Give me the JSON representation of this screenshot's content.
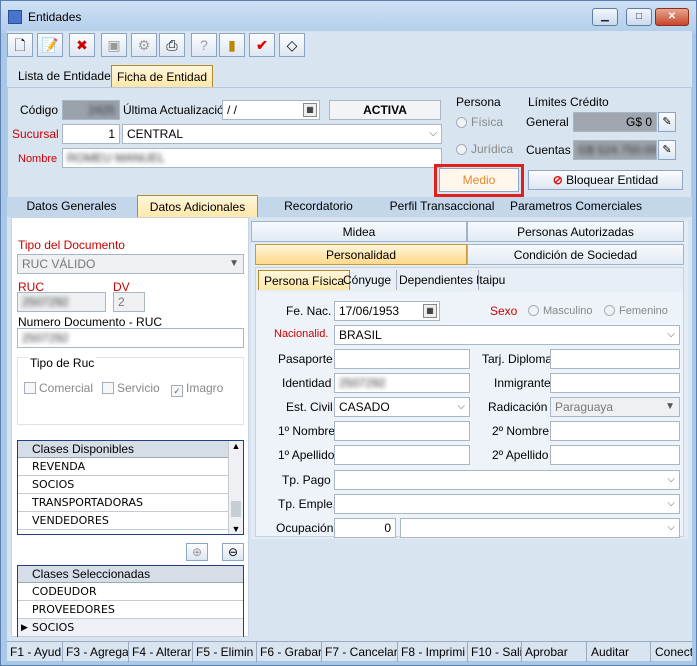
{
  "window": {
    "title": "Entidades"
  },
  "toolbar": {
    "icons": [
      "new-document-icon",
      "edit-document-icon",
      "delete-icon",
      "save-icon",
      "tools-icon",
      "print-icon",
      "help-icon",
      "exit-door-icon",
      "check-icon",
      "eraser-icon"
    ]
  },
  "main_tabs": [
    {
      "label": "Lista de Entidades"
    },
    {
      "label": "Ficha de Entidad"
    }
  ],
  "header": {
    "codigo_label": "Código",
    "codigo_value": "2425",
    "ultima_label": "Última Actualización",
    "ultima_value": "/ /",
    "status": "ACTIVA",
    "sucursal_label": "Sucursal",
    "sucursal_num": "1",
    "sucursal_name": "CENTRAL",
    "nombre_label": "Nombre",
    "nombre_value": "ROMEU MANUEL",
    "persona_label": "Persona",
    "fisica_label": "Física",
    "juridica_label": "Jurídica",
    "limites_label": "Límites Crédito",
    "general_label": "General",
    "general_value": "G$ 0",
    "cuentas_label": "Cuentas",
    "cuentas_value": "G$ 524.750.000",
    "medio_label": "Medio",
    "bloquear_label": "Bloquear Entidad"
  },
  "section_tabs": [
    {
      "label": "Datos Generales"
    },
    {
      "label": "Datos Adicionales"
    },
    {
      "label": "Recordatorio"
    },
    {
      "label": "Perfil Transaccional"
    },
    {
      "label": "Parametros Comerciales"
    }
  ],
  "left": {
    "tipo_doc_label": "Tipo del Documento",
    "tipo_doc_value": "RUC VÁLIDO",
    "ruc_label": "RUC",
    "ruc_value": "2507292",
    "dv_label": "DV",
    "dv_value": "2",
    "numdoc_label": "Numero Documento - RUC",
    "numdoc_value": "2507292",
    "tipo_ruc_label": "Tipo de Ruc",
    "comercial_label": "Comercial",
    "servicio_label": "Servicio",
    "imagro_label": "Imagro",
    "disponibles_header": "Clases Disponibles",
    "disponibles": [
      "REVENDA",
      "SOCIOS",
      "TRANSPORTADORAS",
      "VENDEDORES"
    ],
    "seleccionadas_header": "Clases Seleccionadas",
    "seleccionadas": [
      "CODEUDOR",
      "PROVEEDORES",
      "SOCIOS"
    ]
  },
  "right_tabs_row1": [
    {
      "label": "Midea"
    },
    {
      "label": "Personas Autorizadas"
    }
  ],
  "right_tabs_row2": [
    {
      "label": "Personalidad"
    },
    {
      "label": "Condición de Sociedad"
    }
  ],
  "right_tabs_row3": [
    {
      "label": "Persona Física"
    },
    {
      "label": "Cónyuge"
    },
    {
      "label": "Dependientes"
    },
    {
      "label": "Itaipu"
    }
  ],
  "form": {
    "fe_nac_label": "Fe. Nac.",
    "fe_nac_value": "17/06/1953",
    "sexo_label": "Sexo",
    "masculino_label": "Masculino",
    "femenino_label": "Femenino",
    "nacionalid_label": "Nacionalid.",
    "nacionalid_value": "BRASIL",
    "pasaporte_label": "Pasaporte",
    "tarj_label": "Tarj. Diploma",
    "identidad_label": "Identidad",
    "identidad_value": "2507292",
    "inmigrante_label": "Inmigrante",
    "est_civil_label": "Est. Civil",
    "est_civil_value": "CASADO",
    "radicacion_label": "Radicación",
    "radicacion_value": "Paraguaya",
    "nombre1_label": "1º Nombre",
    "nombre2_label": "2º Nombre",
    "apellido1_label": "1º Apellido",
    "apellido2_label": "2º Apellido",
    "tp_pago_label": "Tp. Pago",
    "tp_emple_label": "Tp. Emple.",
    "ocupacion_label": "Ocupación",
    "ocupacion_value": "0"
  },
  "statusbar": [
    {
      "label": "F1 - Ayud"
    },
    {
      "label": "F3 - Agrega"
    },
    {
      "label": "F4 - Alterar"
    },
    {
      "label": "F5 - Elimin"
    },
    {
      "label": "F6 - Grabar"
    },
    {
      "label": "F7 - Cancelar"
    },
    {
      "label": "F8 - Imprimi"
    },
    {
      "label": "F10 - Sali"
    },
    {
      "label": "Aprobar"
    },
    {
      "label": "Auditar"
    },
    {
      "label": "Conect"
    }
  ],
  "colors": {
    "highlight_box": "#e0201c",
    "active_tab": "#ffe0a0",
    "label_red": "#cc0000",
    "list_border": "#1f3f86"
  }
}
